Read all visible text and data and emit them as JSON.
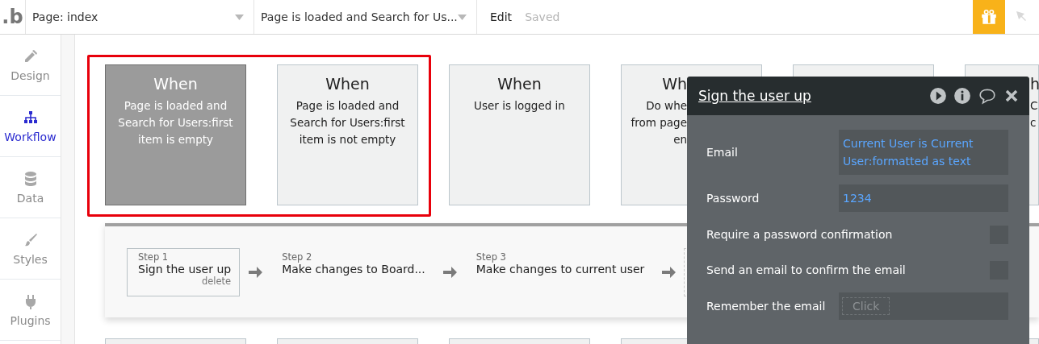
{
  "topbar": {
    "logo": ".b",
    "page_select": "Page: index",
    "event_select": "Page is loaded and Search for Us...",
    "menu": [
      {
        "label": "Edit",
        "disabled": false
      },
      {
        "label": "Saved",
        "disabled": true
      }
    ]
  },
  "sidebar": {
    "items": [
      {
        "label": "Design",
        "selected": false
      },
      {
        "label": "Workflow",
        "selected": true
      },
      {
        "label": "Data",
        "selected": false
      },
      {
        "label": "Styles",
        "selected": false
      },
      {
        "label": "Plugins",
        "selected": false
      }
    ]
  },
  "events": [
    {
      "kind": "full",
      "title": "When",
      "lines": [
        "Page is loaded and",
        "Search for Users:first",
        "item is empty"
      ],
      "selected": true
    },
    {
      "kind": "full",
      "title": "When",
      "lines": [
        "Page is loaded and",
        "Search for Users:first",
        "item is not empty"
      ],
      "selected": false
    },
    {
      "kind": "full",
      "title": "When",
      "lines": [
        "User is logged in"
      ],
      "selected": false
    },
    {
      "kind": "clipped",
      "title": "Wh",
      "lines": [
        "Do whe",
        "from page",
        "en"
      ],
      "selected": false
    },
    {
      "kind": "clipped",
      "selected": false
    },
    {
      "kind": "trailing",
      "title": "h",
      "lines": [
        "C",
        "c"
      ],
      "selected": false
    }
  ],
  "steps": [
    {
      "label": "Step 1",
      "action": "Sign the user up",
      "delete": "delete",
      "selected": true
    },
    {
      "label": "Step 2",
      "action": "Make changes to Board...",
      "selected": false
    },
    {
      "label": "Step 3",
      "action": "Make changes to current user",
      "selected": false
    }
  ],
  "panel": {
    "title": "Sign the user up",
    "fields": [
      {
        "kind": "value",
        "label": "Email",
        "value": "Current User is Current User:formatted as text"
      },
      {
        "kind": "value",
        "label": "Password",
        "value": "1234"
      },
      {
        "kind": "checkbox",
        "label": "Require a password confirmation",
        "checked": false
      },
      {
        "kind": "checkbox",
        "label": "Send an email to confirm the email",
        "checked": false
      },
      {
        "kind": "click",
        "label": "Remember the email",
        "value": "Click"
      }
    ]
  }
}
